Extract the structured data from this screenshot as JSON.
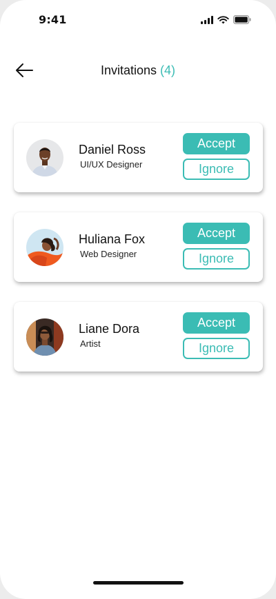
{
  "status_bar": {
    "time": "9:41",
    "icons": [
      "signal-icon",
      "wifi-icon",
      "battery-icon"
    ]
  },
  "header": {
    "back_icon": "arrow-left-icon",
    "title": "Invitations",
    "count": "(4)"
  },
  "colors": {
    "accent": "#3bbcb4",
    "text": "#111111",
    "card_bg": "#ffffff"
  },
  "invitations": [
    {
      "name": "Daniel Ross",
      "role": "UI/UX Designer",
      "accept_label": "Accept",
      "ignore_label": "Ignore"
    },
    {
      "name": "Huliana Fox",
      "role": "Web Designer",
      "accept_label": "Accept",
      "ignore_label": "Ignore"
    },
    {
      "name": "Liane Dora",
      "role": "Artist",
      "accept_label": "Accept",
      "ignore_label": "Ignore"
    }
  ]
}
